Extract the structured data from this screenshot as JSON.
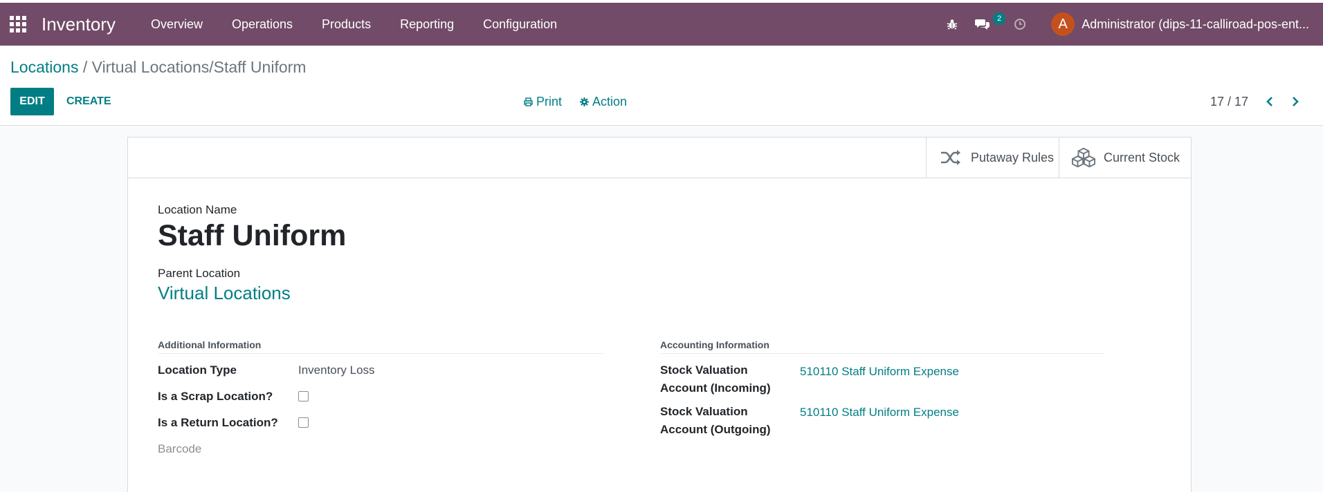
{
  "navbar": {
    "brand": "Inventory",
    "menu": [
      "Overview",
      "Operations",
      "Products",
      "Reporting",
      "Configuration"
    ],
    "messages_count": "2",
    "avatar_letter": "A",
    "user": "Administrator (dips-11-calliroad-pos-ent..."
  },
  "breadcrumb": {
    "root": "Locations",
    "current": " / Virtual Locations/Staff Uniform"
  },
  "buttons": {
    "edit": "EDIT",
    "create": "CREATE",
    "print": "Print",
    "action": "Action"
  },
  "pager": {
    "value": "17 / 17"
  },
  "smart_buttons": {
    "putaway": "Putaway Rules",
    "stock": "Current Stock"
  },
  "form": {
    "location_name_label": "Location Name",
    "location_name": "Staff Uniform",
    "parent_label": "Parent Location",
    "parent": "Virtual Locations",
    "additional": {
      "title": "Additional Information",
      "type_label": "Location Type",
      "type_value": "Inventory Loss",
      "scrap_label": "Is a Scrap Location?",
      "scrap_checked": false,
      "return_label": "Is a Return Location?",
      "return_checked": false,
      "barcode_label": "Barcode"
    },
    "accounting": {
      "title": "Accounting Information",
      "incoming_label_1": "Stock Valuation",
      "incoming_label_2": "Account (Incoming)",
      "incoming_value": "510110 Staff Uniform Expense",
      "outgoing_label_1": "Stock Valuation",
      "outgoing_label_2": "Account (Outgoing)",
      "outgoing_value": "510110 Staff Uniform Expense"
    }
  },
  "colors": {
    "navbar": "#714b67",
    "primary": "#017e84",
    "avatar": "#c4511d"
  },
  "icons": [
    "apps-grid-icon",
    "bug-icon",
    "chat-icon",
    "clock-icon",
    "print-icon",
    "gear-icon",
    "chevron-left-icon",
    "chevron-right-icon",
    "shuffle-icon",
    "cubes-icon"
  ]
}
